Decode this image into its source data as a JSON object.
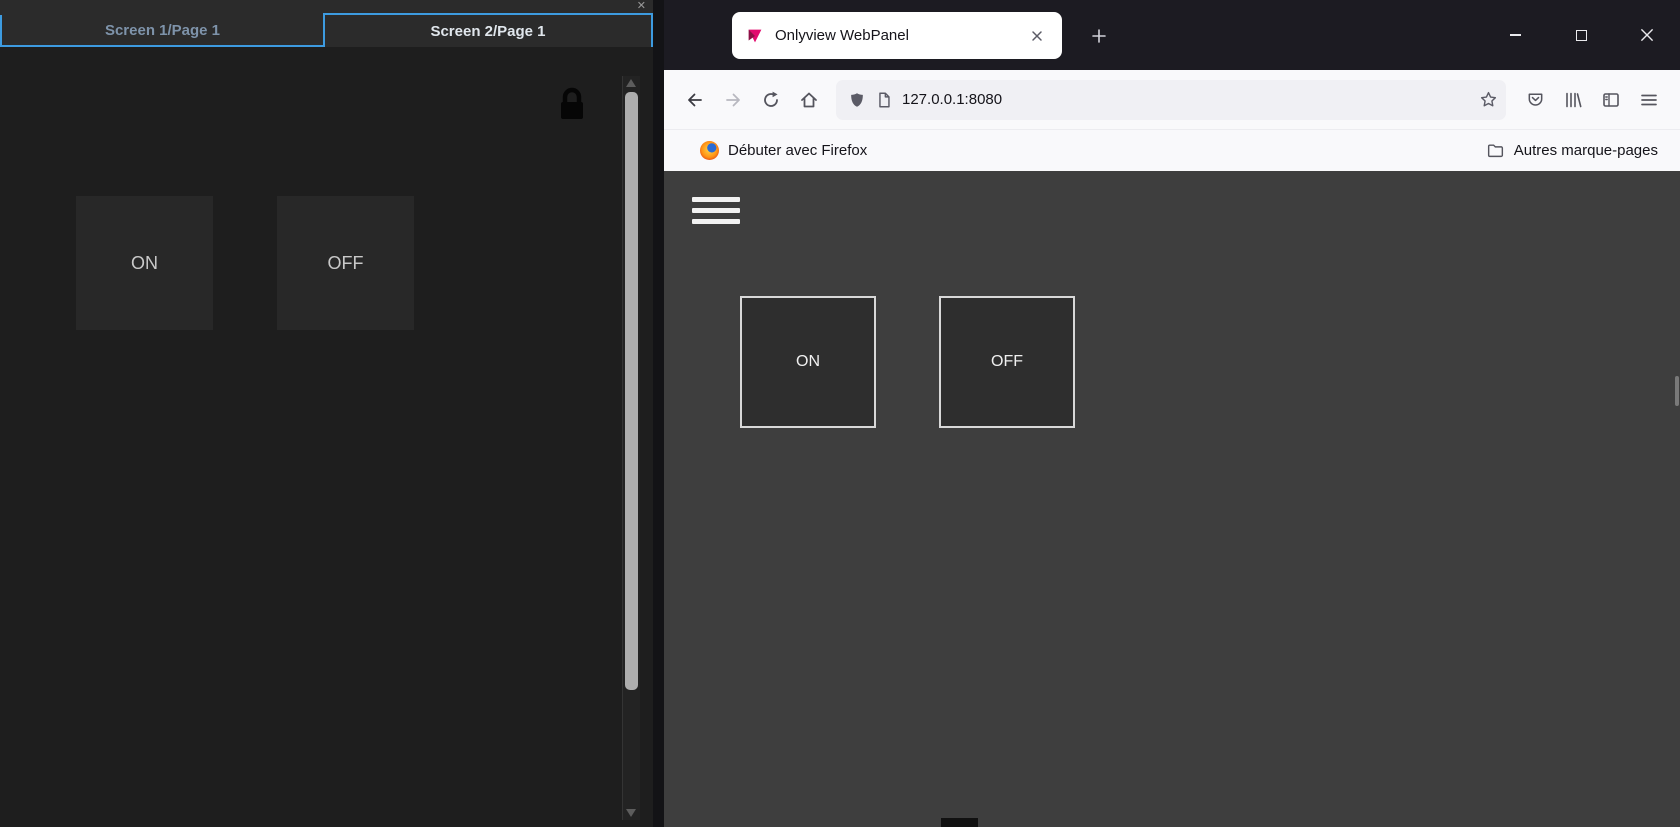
{
  "colors": {
    "accent": "#3d9be0",
    "logo_pink": "#e20a6e",
    "browser_chrome": "#1c1b22",
    "toolbar_bg": "#f9f9fb",
    "page_bg": "#3e3e3e"
  },
  "left_app": {
    "pane_close": "✕",
    "tabs": [
      {
        "label": "Screen 1/Page 1",
        "active": false
      },
      {
        "label": "Screen 2/Page 1",
        "active": true
      }
    ],
    "buttons": [
      {
        "label": "ON"
      },
      {
        "label": "OFF"
      }
    ],
    "icons": {
      "lock": "padlock-icon"
    }
  },
  "browser": {
    "titlebar": {
      "tab_title": "Onlyview WebPanel",
      "icons": {
        "tab_logo": "onlyview-logo-icon",
        "tab_close": "close-icon",
        "new_tab": "plus-icon",
        "minimize": "minimize-icon",
        "maximize": "maximize-icon",
        "close": "close-icon"
      }
    },
    "toolbar": {
      "url": "127.0.0.1:8080",
      "icons": {
        "back": "arrow-left-icon",
        "forward": "arrow-right-icon",
        "reload": "reload-icon",
        "home": "home-icon",
        "shield": "shield-icon",
        "page": "page-icon",
        "bookmark": "star-icon",
        "pocket": "pocket-icon",
        "library": "library-icon",
        "sidebar": "sidebar-icon",
        "menu": "hamburger-icon"
      }
    },
    "bookmarks": {
      "items": [
        {
          "label": "Débuter avec Firefox",
          "icon": "firefox-logo-icon"
        }
      ],
      "other": {
        "label": "Autres marque-pages",
        "icon": "folder-icon"
      }
    },
    "page": {
      "menu_icon": "hamburger-icon",
      "buttons": [
        {
          "label": "ON"
        },
        {
          "label": "OFF"
        }
      ]
    }
  }
}
